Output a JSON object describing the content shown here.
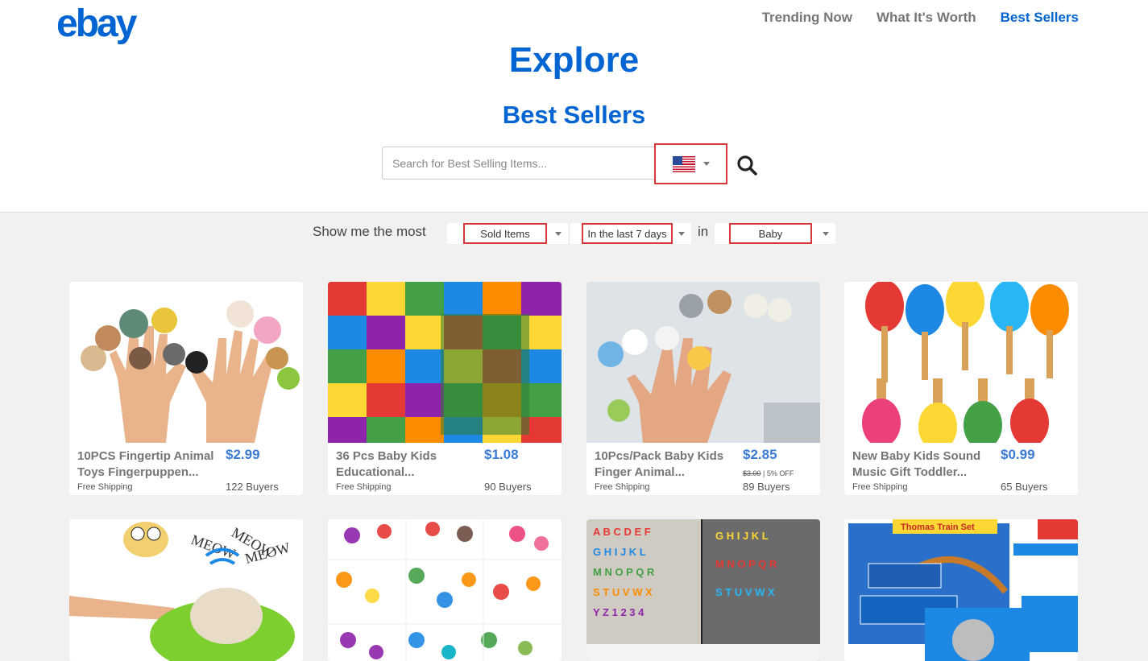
{
  "header": {
    "logo_letters": [
      "e",
      "b",
      "a",
      "y"
    ],
    "nav": [
      {
        "label": "Trending Now",
        "active": false
      },
      {
        "label": "What It's Worth",
        "active": false
      },
      {
        "label": "Best Sellers",
        "active": true
      }
    ],
    "title": "Explore",
    "subtitle": "Best Sellers"
  },
  "search": {
    "placeholder": "Search for Best Selling Items...",
    "value": "",
    "country_icon": "us-flag-icon",
    "button_icon": "search-icon"
  },
  "filters": {
    "prefix": "Show me the most",
    "metric": "Sold Items",
    "period": "In the last 7 days",
    "in_label": "in",
    "category": "Baby"
  },
  "colors": {
    "brand_blue": "#0064d2",
    "price_blue": "#3a7bd5",
    "highlight_red": "#d9383b",
    "background_grey": "#f1f1f1"
  },
  "items": [
    {
      "title_line1": "10PCS Fingertip Animal",
      "title_line2": "Toys Fingerpuppen...",
      "price": "$2.99",
      "original_price": "",
      "discount": "",
      "shipping": "Free Shipping",
      "buyers": "122 Buyers",
      "image": "finger-puppets-hands"
    },
    {
      "title_line1": "36 Pcs Baby Kids",
      "title_line2": "Educational...",
      "price": "$1.08",
      "original_price": "",
      "discount": "",
      "shipping": "Free Shipping",
      "buyers": "90 Buyers",
      "image": "foam-alphabet-puzzle"
    },
    {
      "title_line1": "10Pcs/Pack Baby Kids",
      "title_line2": "Finger Animal...",
      "price": "$2.85",
      "original_price": "$3.00",
      "discount": "| 5% OFF",
      "shipping": "Free Shipping",
      "buyers": "89 Buyers",
      "image": "finger-puppets-hand"
    },
    {
      "title_line1": "New Baby Kids Sound",
      "title_line2": "Music Gift Toddler...",
      "price": "$0.99",
      "original_price": "",
      "discount": "",
      "shipping": "Free Shipping",
      "buyers": "65 Buyers",
      "image": "wooden-maracas"
    },
    {
      "image": "plush-kitten-sound-toy",
      "texts": [
        "MEOW",
        "MEOW",
        "MEOW"
      ]
    },
    {
      "image": "butterfly-wall-stickers"
    },
    {
      "image": "magnetic-letters-fridge",
      "texts": [
        "A B C D E F",
        "G H I J K L",
        "M N O P Q R",
        "S T U V W X",
        "Y Z 1 2 3 4"
      ]
    },
    {
      "image": "thomas-train-set",
      "texts": [
        "Thomas Train Set"
      ]
    }
  ]
}
